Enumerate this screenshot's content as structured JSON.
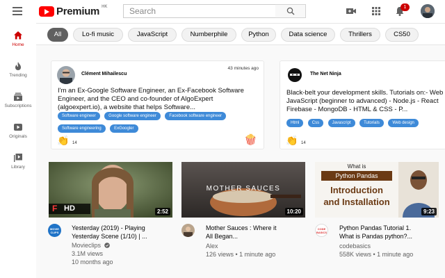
{
  "header": {
    "logo_text": "Premium",
    "region": "HK",
    "search_placeholder": "Search",
    "notification_count": "1"
  },
  "sidebar": {
    "items": [
      {
        "label": "Home"
      },
      {
        "label": "Trending"
      },
      {
        "label": "Subscriptions"
      },
      {
        "label": "Originals"
      },
      {
        "label": "Library"
      }
    ]
  },
  "chips": [
    "All",
    "Lo-fi music",
    "JavaScript",
    "Numberphile",
    "Python",
    "Data science",
    "Thrillers",
    "CS50"
  ],
  "cards": [
    {
      "name": "Clément Mihailescu",
      "time": "43 minutes ago",
      "desc_lines": [
        "I'm an Ex-Google Software Engineer, an Ex-Facebook Software",
        "Engineer, and the CEO and co-founder of AlgoExpert",
        "(algoexpert.io), a website that helps Software..."
      ],
      "tags": [
        "Software engineer",
        "Google software engineer",
        "Facebook software engineer",
        "Software engineering",
        "ExGoogler"
      ],
      "claps": "14"
    },
    {
      "name": "The Net Ninja",
      "desc_lines": [
        "Black-belt your development skills. Tutorials on:- Web",
        "JavaScript (beginner to advanced) - Node.js - React",
        "Firebase - MongoDB - HTML & CSS - P..."
      ],
      "tags": [
        "Html",
        "Css",
        "Javascript",
        "Tutorials",
        "Web design"
      ],
      "claps": "14"
    }
  ],
  "videos": [
    {
      "title_lines": [
        "Yesterday (2019) - Playing",
        "Yesterday Scene (1/10) | ..."
      ],
      "channel": "Movieclips",
      "views": "3.1M views",
      "age": "10 months ago",
      "duration": "2:52",
      "badge": "HD",
      "channel_logo": "MOVIE CLIPS"
    },
    {
      "title_lines": [
        "Mother Sauces : Where it",
        "All Began..."
      ],
      "channel": "Alex",
      "views": "126 views • 1 minute ago",
      "duration": "10:20",
      "overlay": "MOTHER SAUCES"
    },
    {
      "title_lines": [
        "Python Pandas Tutorial 1.",
        "What is Pandas python?..."
      ],
      "channel": "codebasics",
      "views": "558K views • 1 minute ago",
      "duration": "9:23",
      "overlay_top": "What is",
      "overlay_mid": "Python Pandas",
      "overlay_bottom_1": "Introduction",
      "overlay_bottom_2": "and Installation",
      "channel_logo": "CODE BASICS"
    }
  ],
  "colors": {
    "brand_red": "#ff0000",
    "active_red": "#cc0000",
    "tag_blue": "#3e8ad8",
    "chip_active": "#606060"
  }
}
